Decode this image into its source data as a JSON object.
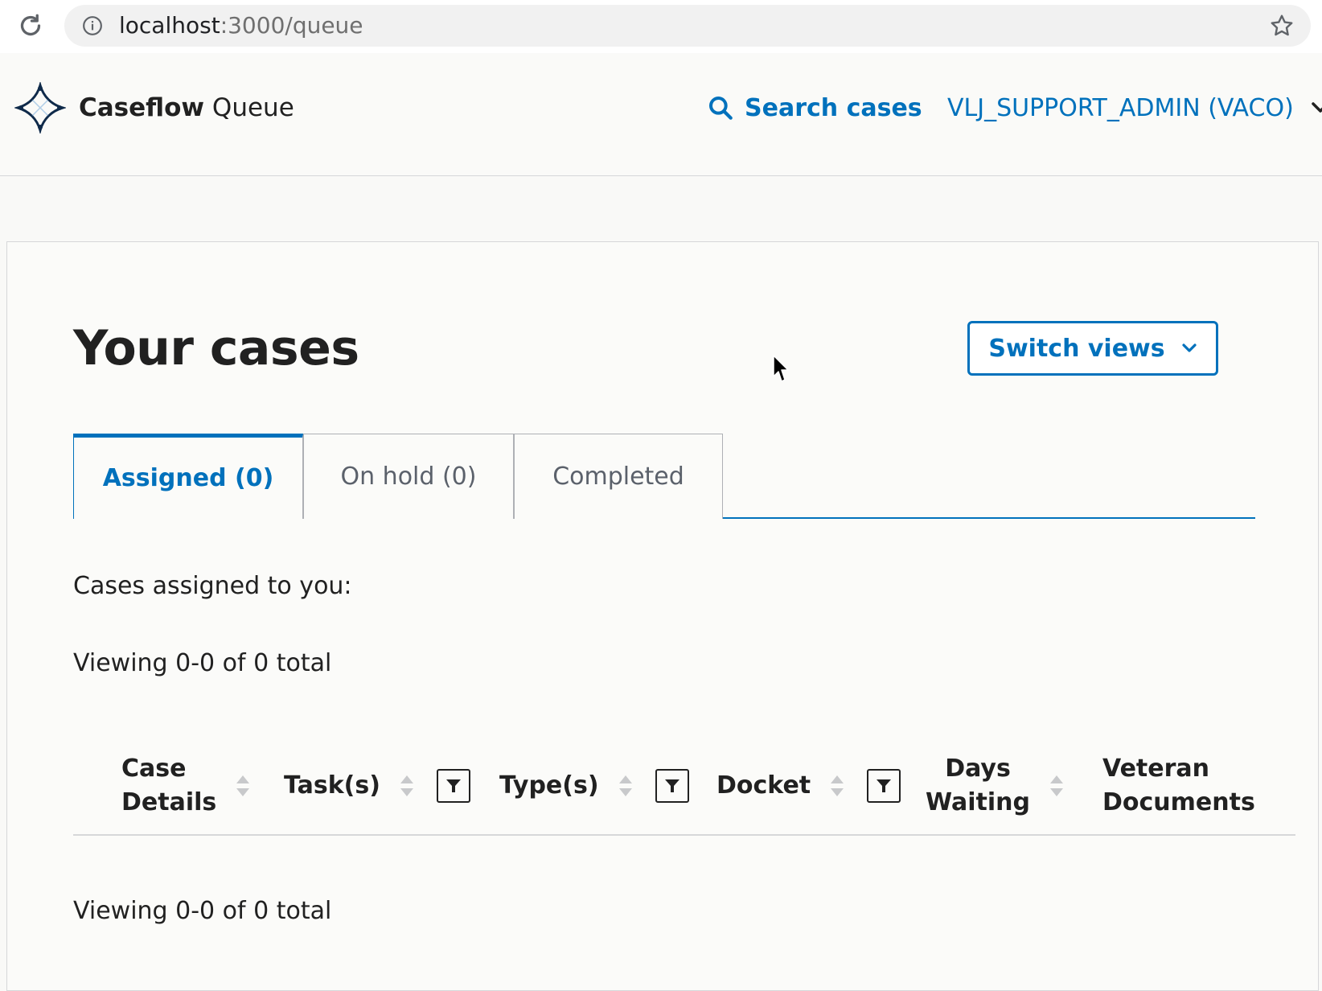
{
  "browser": {
    "url_host": "localhost",
    "url_path": ":3000/queue"
  },
  "header": {
    "brand": "Caseflow",
    "app_name": "Queue",
    "search_label": "Search cases",
    "user_label": "VLJ_SUPPORT_ADMIN (VACO)"
  },
  "page": {
    "title": "Your cases",
    "switch_views_label": "Switch views"
  },
  "tabs": [
    {
      "label": "Assigned (0)",
      "active": true
    },
    {
      "label": "On hold (0)",
      "active": false
    },
    {
      "label": "Completed",
      "active": false
    }
  ],
  "content": {
    "intro": "Cases assigned to you:",
    "viewing_top": "Viewing 0-0 of 0 total",
    "viewing_bottom": "Viewing 0-0 of 0 total"
  },
  "table": {
    "columns": [
      {
        "label_line1": "Case",
        "label_line2": "Details",
        "sortable": true,
        "filterable": false
      },
      {
        "label_line1": "Task(s)",
        "label_line2": "",
        "sortable": true,
        "filterable": true
      },
      {
        "label_line1": "Type(s)",
        "label_line2": "",
        "sortable": true,
        "filterable": true
      },
      {
        "label_line1": "Docket",
        "label_line2": "",
        "sortable": true,
        "filterable": true
      },
      {
        "label_line1": "Days",
        "label_line2": "Waiting",
        "sortable": true,
        "filterable": false
      },
      {
        "label_line1": "Veteran",
        "label_line2": "Documents",
        "sortable": false,
        "filterable": false
      }
    ]
  },
  "colors": {
    "primary": "#0071bc",
    "text": "#212121",
    "muted": "#5b616b",
    "border": "#d6d7d9"
  }
}
